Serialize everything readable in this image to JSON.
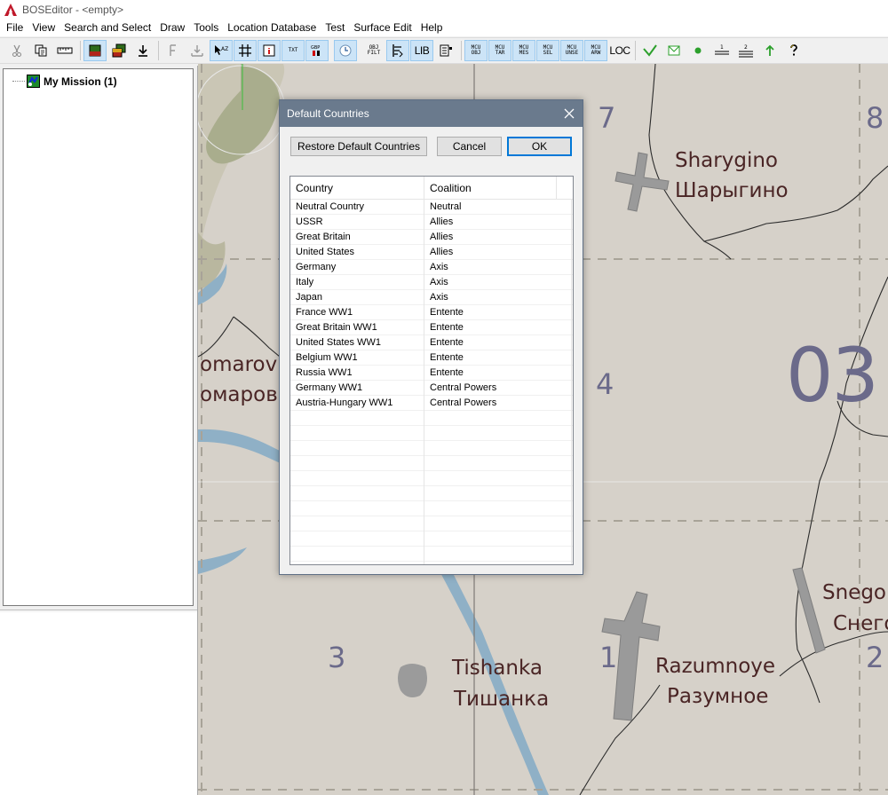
{
  "window": {
    "title": "BOSEditor - <empty>",
    "icon": "boseditor-app-icon"
  },
  "menu": [
    "File",
    "View",
    "Search and Select",
    "Draw",
    "Tools",
    "Location Database",
    "Test",
    "Surface Edit",
    "Help"
  ],
  "toolbar": {
    "txt_label": "TXT",
    "obj_filt": [
      "OBJ",
      "FILT"
    ],
    "lib_label": "LIB",
    "mcu_obj": [
      "MCU",
      "OBJ"
    ],
    "mcu_tar": [
      "MCU",
      "TAR"
    ],
    "mcu_mes": [
      "MCU",
      "MES"
    ],
    "mcu_sel": [
      "MCU",
      "SEL"
    ],
    "mcu_unse": [
      "MCU",
      "UNSE"
    ],
    "mcu_arw": [
      "MCU",
      "ARW"
    ],
    "loc_label": "LOC",
    "colors": {
      "pressed_bg": "#cce4f7",
      "green": "#2ca02c"
    }
  },
  "tree": {
    "root_label": "My Mission (1)"
  },
  "map": {
    "grid_numbers": [
      "7",
      "8",
      "4",
      "3",
      "1",
      "2"
    ],
    "large_label": "03",
    "places": [
      {
        "latin": "Sharygino",
        "cyrillic": "Шарыгино"
      },
      {
        "latin": "omarov",
        "cyrillic": "омаров"
      },
      {
        "latin": "Snego",
        "cyrillic": "Снего"
      },
      {
        "latin": "Tishanka",
        "cyrillic": "Тишанка"
      },
      {
        "latin": "Razumnoye",
        "cyrillic": "Разумное"
      }
    ],
    "colors": {
      "land": "#d6d1c9",
      "water": "#8fb0c6",
      "forest": "#a9ad8d",
      "airfield": "#9a9a9a"
    }
  },
  "dialog": {
    "title": "Default Countries",
    "buttons": {
      "restore": "Restore Default Countries",
      "cancel": "Cancel",
      "ok": "OK"
    },
    "columns": [
      "Country",
      "Coalition"
    ],
    "rows": [
      {
        "country": "Neutral Country",
        "coalition": "Neutral"
      },
      {
        "country": "USSR",
        "coalition": "Allies"
      },
      {
        "country": "Great Britain",
        "coalition": "Allies"
      },
      {
        "country": "United States",
        "coalition": "Allies"
      },
      {
        "country": "Germany",
        "coalition": "Axis"
      },
      {
        "country": "Italy",
        "coalition": "Axis"
      },
      {
        "country": "Japan",
        "coalition": "Axis"
      },
      {
        "country": "France WW1",
        "coalition": "Entente"
      },
      {
        "country": "Great Britain WW1",
        "coalition": "Entente"
      },
      {
        "country": "United States WW1",
        "coalition": "Entente"
      },
      {
        "country": "Belgium WW1",
        "coalition": "Entente"
      },
      {
        "country": "Russia WW1",
        "coalition": "Entente"
      },
      {
        "country": "Germany WW1",
        "coalition": "Central Powers"
      },
      {
        "country": "Austria-Hungary WW1",
        "coalition": "Central Powers"
      }
    ]
  }
}
